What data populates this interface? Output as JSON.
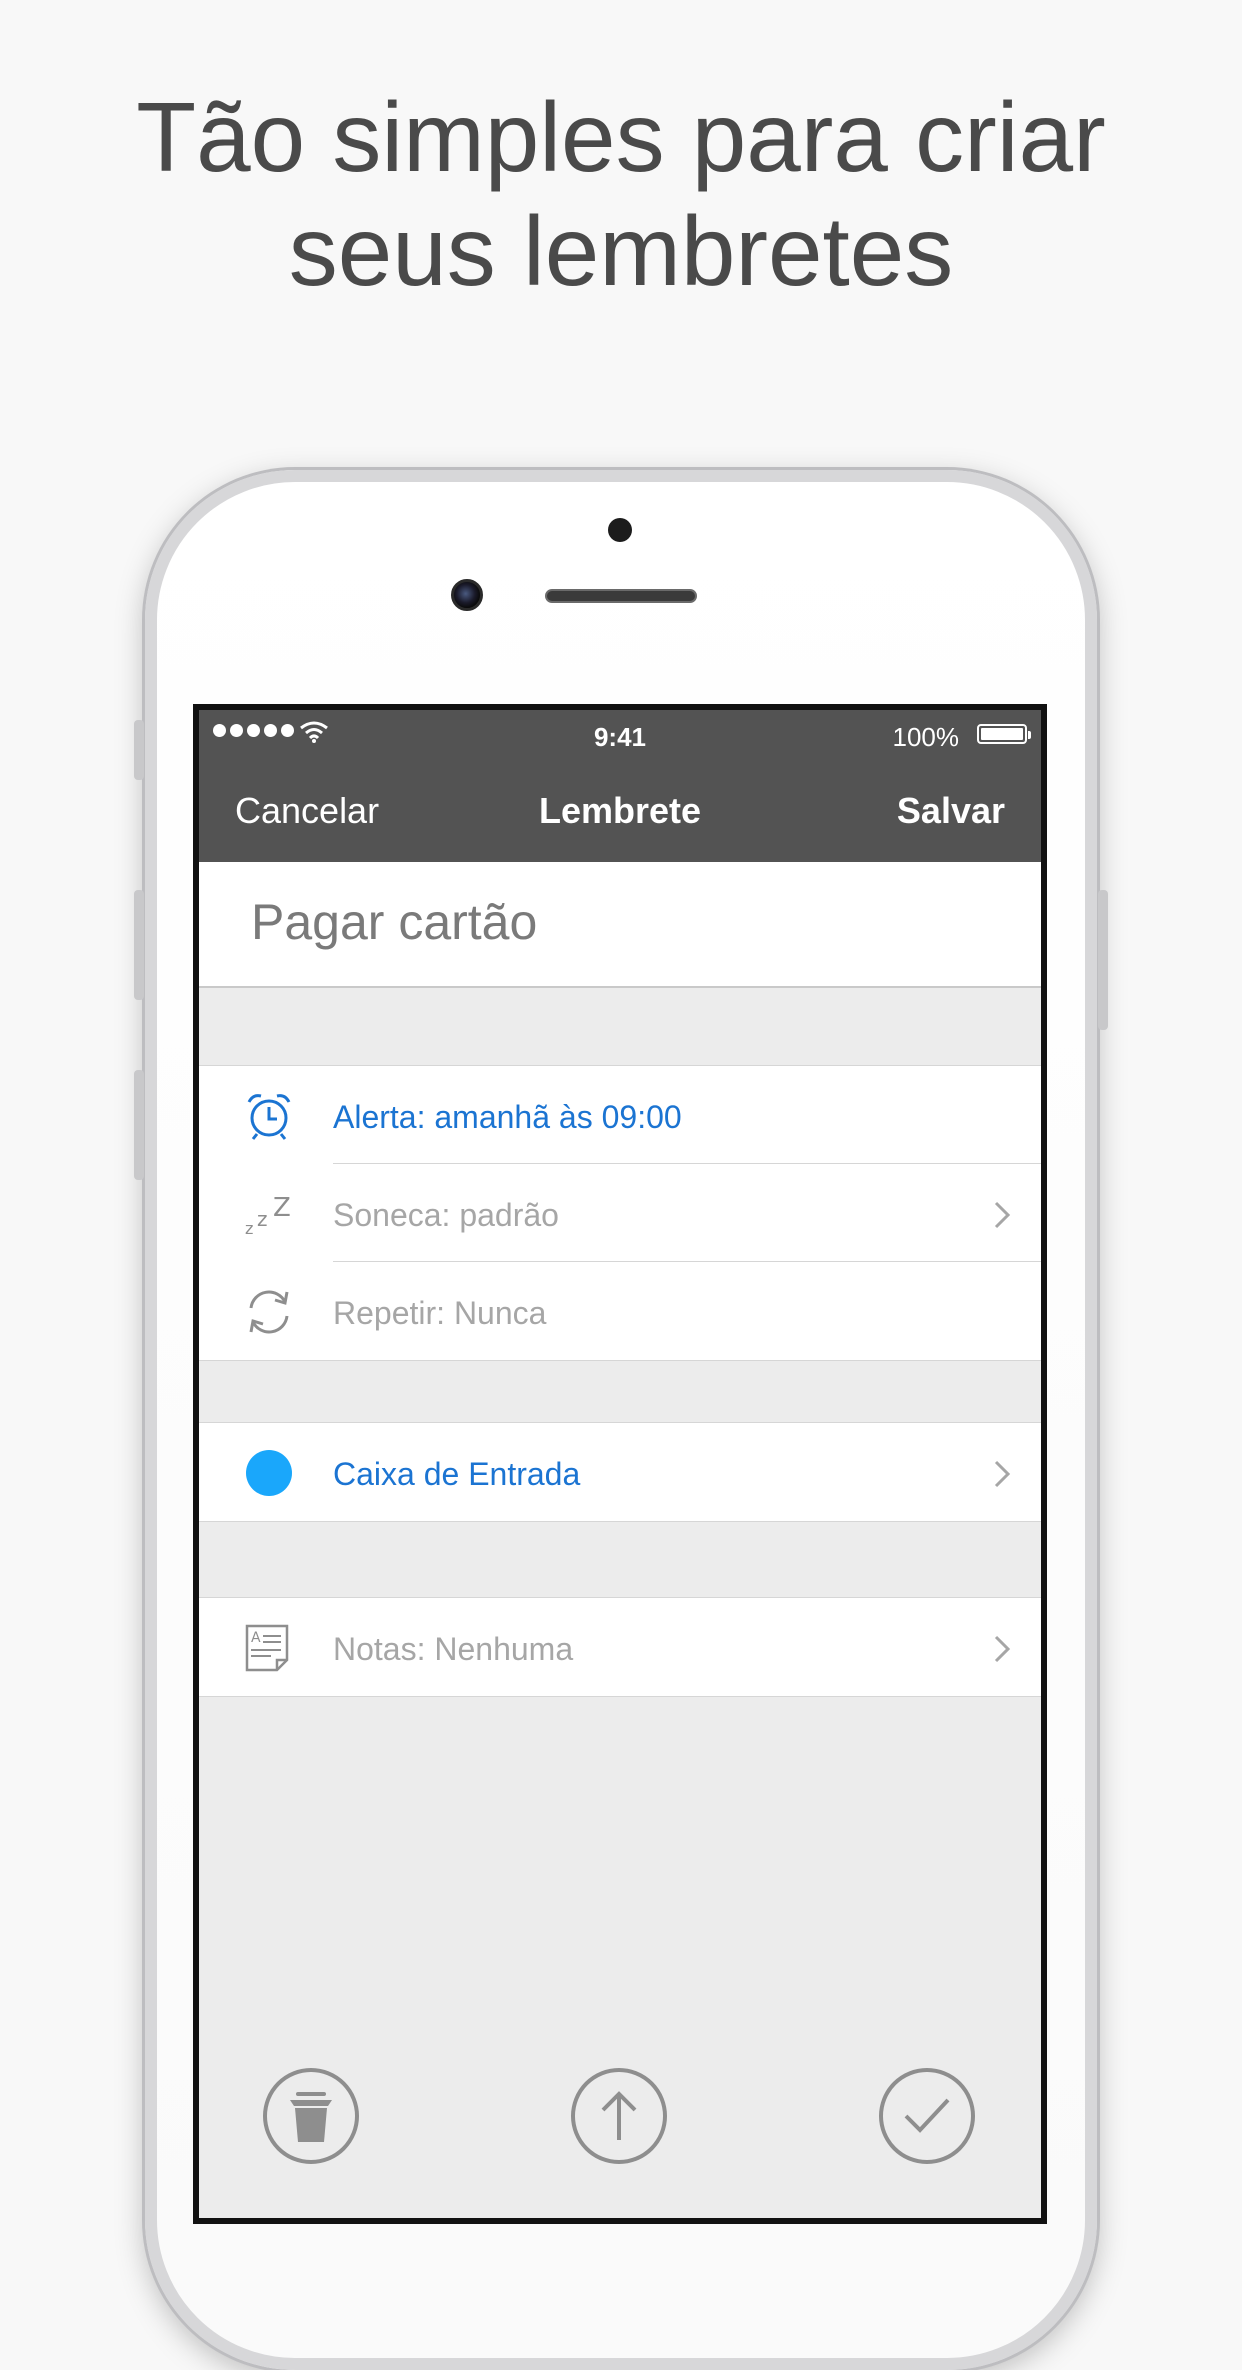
{
  "headline": {
    "line1": "Tão simples para criar",
    "line2": "seus lembretes"
  },
  "status_bar": {
    "time": "9:41",
    "battery": "100%"
  },
  "nav": {
    "left": "Cancelar",
    "title": "Lembrete",
    "right": "Salvar"
  },
  "reminder": {
    "title_value": "Pagar cartão"
  },
  "rows": {
    "alert": "Alerta: amanhã às 09:00",
    "snooze": "Soneca: padrão",
    "repeat": "Repetir: Nunca",
    "list": "Caixa de Entrada",
    "notes": "Notas: Nenhuma"
  },
  "icons": {
    "alert": "alarm-clock-icon",
    "snooze": "zzz-icon",
    "repeat": "repeat-icon",
    "list": "list-color-dot",
    "notes": "notes-icon",
    "toolbar": [
      "trash-icon",
      "share-icon",
      "checkmark-icon"
    ]
  },
  "colors": {
    "accent_blue": "#1b74d2",
    "list_dot": "#1aa7fb",
    "bar_dark": "#535353"
  }
}
